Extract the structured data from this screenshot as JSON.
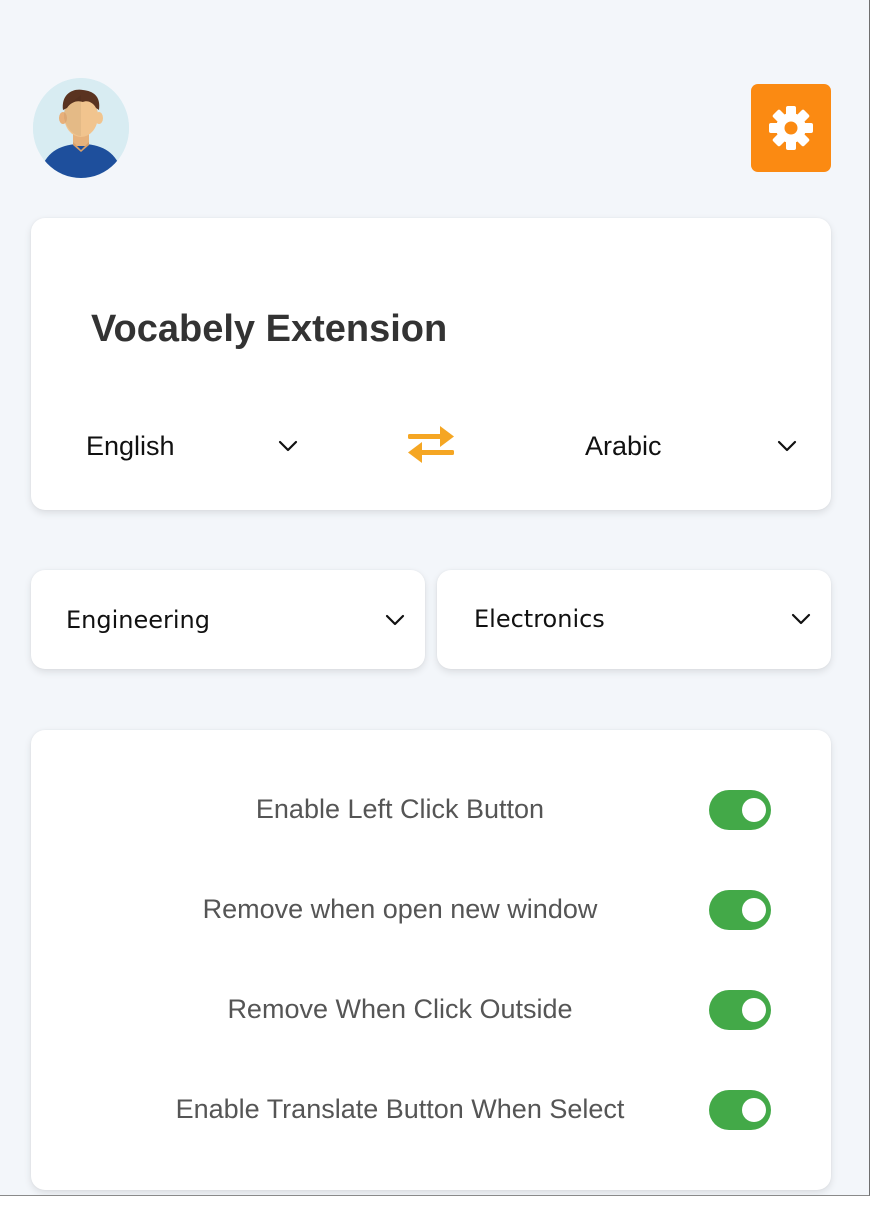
{
  "header": {
    "avatar_icon": "user-avatar-icon",
    "settings_icon": "gear-icon",
    "settings_color": "#fb8a12"
  },
  "language_card": {
    "title": "Vocabely Extension",
    "source_language": "English",
    "target_language": "Arabic",
    "swap_icon": "swap-arrows-icon",
    "swap_color": "#f5a623"
  },
  "categories": {
    "field": "Engineering",
    "subfield": "Electronics"
  },
  "settings": {
    "toggle_color": "#43a948",
    "items": [
      {
        "label": "Enable Left Click Button",
        "enabled": true
      },
      {
        "label": "Remove when open new window",
        "enabled": true
      },
      {
        "label": "Remove When Click Outside",
        "enabled": true
      },
      {
        "label": "Enable Translate Button When Select",
        "enabled": true
      }
    ]
  }
}
